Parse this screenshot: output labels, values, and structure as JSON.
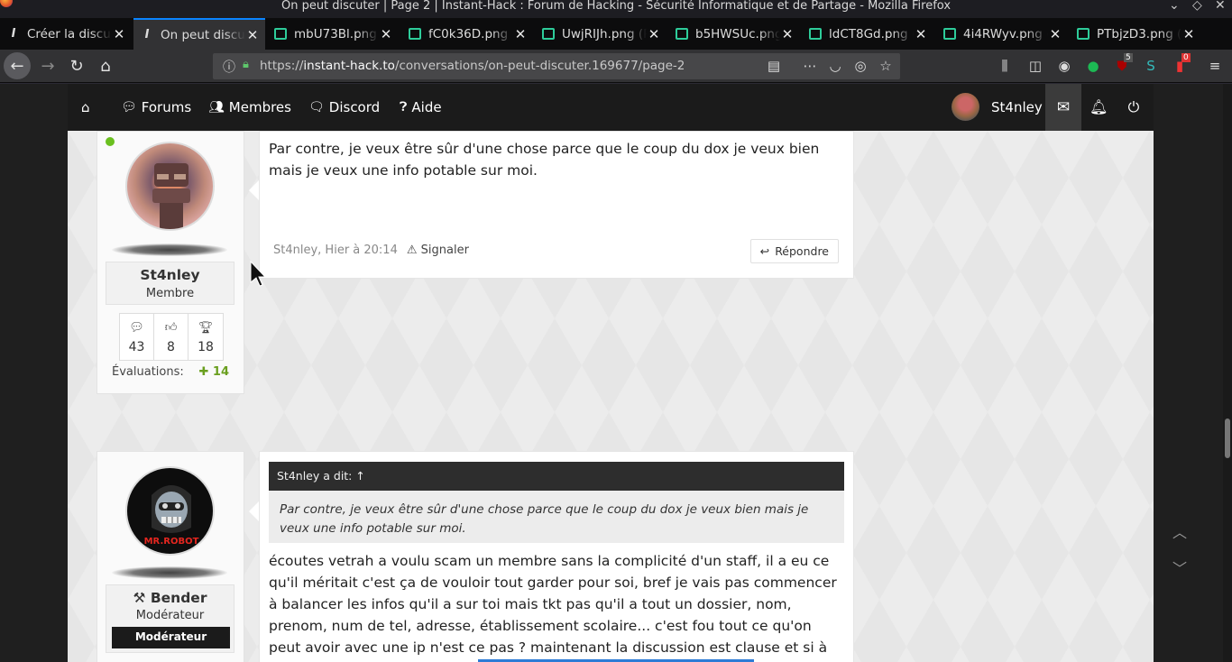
{
  "window": {
    "title": "On peut discuter | Page 2 | Instant-Hack : Forum de Hacking - Sécurité Informatique et de Partage - Mozilla Firefox"
  },
  "tabs": [
    {
      "label": "Créer la discussion",
      "icon": "instant-hack-icon",
      "active": false
    },
    {
      "label": "On peut discuter",
      "icon": "instant-hack-icon",
      "active": true
    },
    {
      "label": "mbU73Bl.png",
      "icon": "image-icon",
      "active": false
    },
    {
      "label": "fC0k36D.png",
      "icon": "image-icon",
      "active": false
    },
    {
      "label": "UwjRIJh.png (P",
      "icon": "image-icon",
      "active": false
    },
    {
      "label": "b5HWSUc.png",
      "icon": "image-icon",
      "active": false
    },
    {
      "label": "ldCT8Gd.png (",
      "icon": "image-icon",
      "active": false
    },
    {
      "label": "4i4RWyv.png (",
      "icon": "image-icon",
      "active": false
    },
    {
      "label": "PTbjzD3.png (",
      "icon": "image-icon",
      "active": false
    }
  ],
  "navbar": {
    "url_prefix": "https://",
    "url_host": "instant-hack.to",
    "url_path": "/conversations/on-peut-discuter.169677/page-2",
    "badge_ublock": "5",
    "badge_other": "0"
  },
  "site_nav": {
    "items": [
      "Forums",
      "Membres",
      "Discord",
      "Aide"
    ],
    "username": "St4nley"
  },
  "post1": {
    "text": "Par contre, je veux être sûr d'une chose parce que le coup du dox je veux bien mais je veux une info potable sur moi.",
    "meta": "St4nley, Hier à 20:14",
    "report": "Signaler",
    "reply": "Répondre",
    "user": {
      "name": "St4nley",
      "role": "Membre",
      "stats": [
        "43",
        "8",
        "18"
      ],
      "evals_label": "Évaluations:",
      "evals_value": "14"
    }
  },
  "post2": {
    "quote_head": "St4nley a dit: ↑",
    "quote_text": "Par contre, je veux être sûr d'une chose parce que le coup du dox je veux bien mais je veux une info potable sur moi.",
    "text": "écoutes vetrah a voulu scam un membre sans la complicité d'un staff, il a eu ce qu'il méritait c'est ça de vouloir tout garder pour soi, bref je vais pas commencer à balancer les infos qu'il a sur toi mais tkt pas qu'il a tout un dossier, nom, prenom, num de tel, adresse, établissement scolaire... c'est fou tout ce qu'on peut avoir avec une ip n'est ce pas ? maintenant la discussion est clause et si à la fin de la semaine",
    "user": {
      "name": "Bender",
      "role": "Modérateur",
      "badge": "Modérateur",
      "avatar_text": "MR.ROBOT"
    }
  },
  "colors": {
    "accent": "#0a84ff",
    "online": "#6abf1f",
    "nav_bg": "#1b1b1b"
  }
}
